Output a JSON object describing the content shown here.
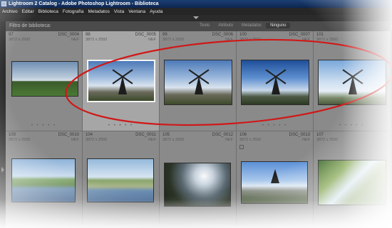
{
  "window": {
    "title": "Lightroom 2 Catalog - Adobe Photoshop Lightroom - Biblioteca"
  },
  "menu": [
    "Archivo",
    "Editar",
    "Biblioteca",
    "Fotografía",
    "Metadatos",
    "Vista",
    "Ventana",
    "Ayuda"
  ],
  "filter_bar": {
    "title": "Filtro de biblioteca:",
    "tabs": [
      "Texto",
      "Atributo",
      "Metadatos",
      "Ninguno"
    ],
    "active_tab": "Ninguno"
  },
  "rows": [
    [
      {
        "index": "97",
        "file": "DSC_0004",
        "dims": "3872 x 2592",
        "type": "NEF",
        "scene": "field"
      },
      {
        "index": "98",
        "file": "DSC_0005",
        "dims": "3872 x 2592",
        "type": "NEF",
        "scene": "windmill",
        "selected": true
      },
      {
        "index": "99",
        "file": "DSC_0006",
        "dims": "3872 x 2592",
        "type": "NEF",
        "scene": "windmill2"
      },
      {
        "index": "100",
        "file": "DSC_0007",
        "dims": "3872 x 2592",
        "type": "NEF",
        "scene": "windmill3"
      },
      {
        "index": "101",
        "file": "",
        "dims": "3872 x 2592",
        "type": "",
        "scene": "windmill4"
      }
    ],
    [
      {
        "index": "103",
        "file": "DSC_0010",
        "dims": "3872 x 2592",
        "type": "NEF",
        "scene": "canal"
      },
      {
        "index": "104",
        "file": "DSC_0011",
        "dims": "3872 x 2592",
        "type": "NEF",
        "scene": "canal2"
      },
      {
        "index": "105",
        "file": "DSC_0012",
        "dims": "3872 x 2592",
        "type": "NEF",
        "scene": "reeds"
      },
      {
        "index": "106",
        "file": "DSC_0013",
        "dims": "3872 x 2592",
        "type": "NEF",
        "scene": "road"
      },
      {
        "index": "107",
        "file": "",
        "dims": "3872 x 2592",
        "type": "",
        "scene": "trees"
      }
    ]
  ],
  "colors": {
    "highlight_ellipse": "#d01818",
    "grid_bg": "#8a8a8a",
    "selected_cell": "#a6a6a6"
  }
}
